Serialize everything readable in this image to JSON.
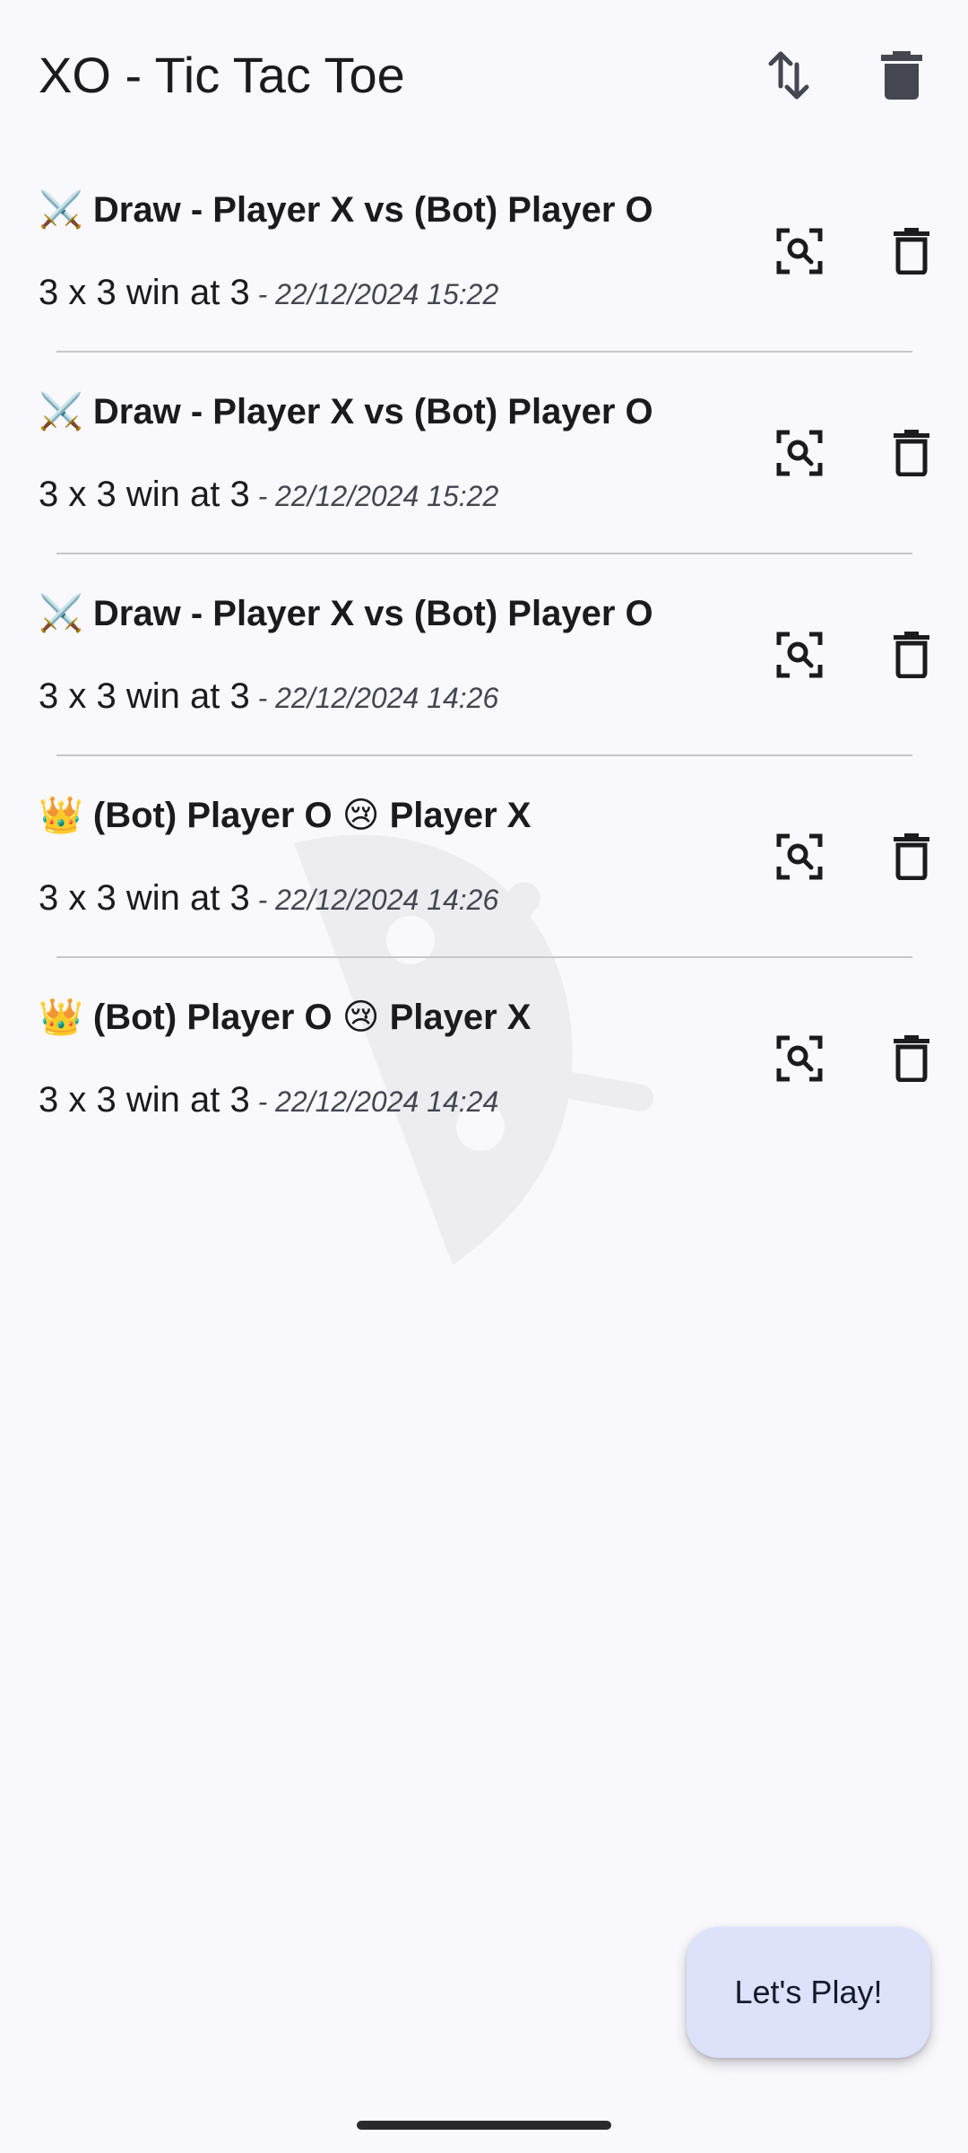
{
  "app_bar": {
    "title": "XO - Tic Tac Toe",
    "sort_icon": "swap-vertical-icon",
    "delete_all_icon": "delete-filled-icon"
  },
  "history": [
    {
      "title": "⚔️ Draw - Player X vs (Bot) Player O",
      "board": "3 x 3 win at 3",
      "date": " - 22/12/2024 15:22",
      "view_icon": "zoom-search-icon",
      "delete_icon": "delete-outline-icon"
    },
    {
      "title": "⚔️ Draw - Player X vs (Bot) Player O",
      "board": "3 x 3 win at 3",
      "date": " - 22/12/2024 15:22",
      "view_icon": "zoom-search-icon",
      "delete_icon": "delete-outline-icon"
    },
    {
      "title": "⚔️ Draw - Player X vs (Bot) Player O",
      "board": "3 x 3 win at 3",
      "date": " - 22/12/2024 14:26",
      "view_icon": "zoom-search-icon",
      "delete_icon": "delete-outline-icon"
    },
    {
      "title": "👑 (Bot) Player O 😢 Player X",
      "board": "3 x 3 win at 3",
      "date": " - 22/12/2024 14:26",
      "view_icon": "zoom-search-icon",
      "delete_icon": "delete-outline-icon"
    },
    {
      "title": "👑 (Bot) Player O 😢 Player X",
      "board": "3 x 3 win at 3",
      "date": " - 22/12/2024 14:24",
      "view_icon": "zoom-search-icon",
      "delete_icon": "delete-outline-icon"
    }
  ],
  "fab": {
    "label": "Let's Play!"
  },
  "colors": {
    "background": "#f8f8fd",
    "fab_background": "#dde1f9",
    "divider": "#c6c6cc"
  }
}
